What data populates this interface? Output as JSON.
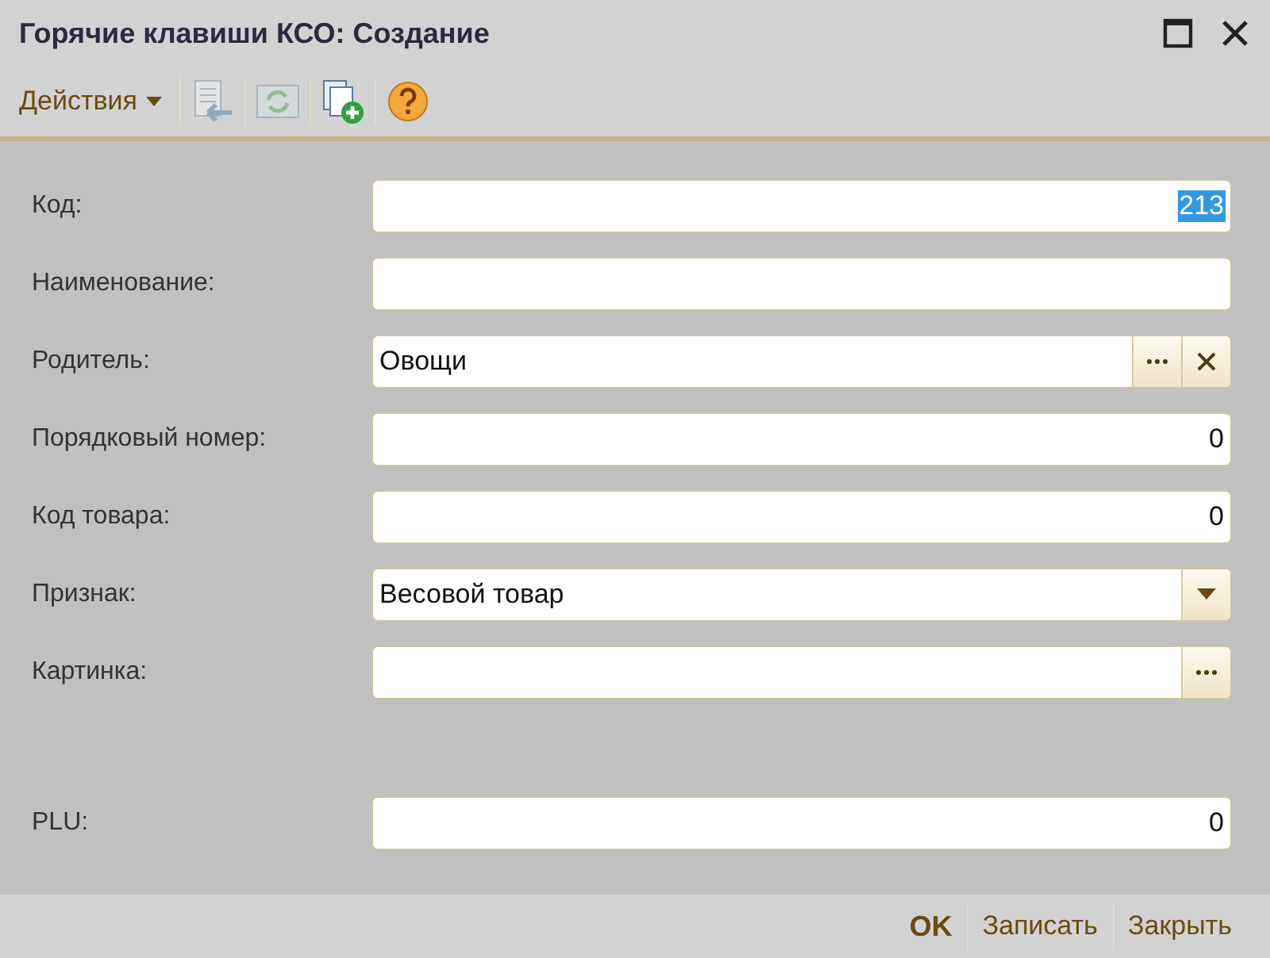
{
  "window": {
    "title": "Горячие клавиши КСО: Создание"
  },
  "toolbar": {
    "menu": "Действия",
    "icons": [
      {
        "kind": "paste",
        "disabled": true
      },
      {
        "kind": "refresh",
        "disabled": true
      },
      {
        "kind": "copy-add",
        "disabled": false
      },
      {
        "kind": "help",
        "disabled": false
      }
    ]
  },
  "fields": [
    {
      "label": "Код:",
      "kind": "number",
      "value": "213",
      "selected": true
    },
    {
      "label": "Наименование:",
      "kind": "text"
    },
    {
      "label": "Родитель:",
      "kind": "reference",
      "value": "Овощи"
    },
    {
      "label": "Порядковый номер:",
      "kind": "number",
      "value": "0"
    },
    {
      "label": "Код товара:",
      "kind": "number",
      "value": "0"
    },
    {
      "label": "Признак:",
      "kind": "dropdown",
      "value": "Весовой товар"
    },
    {
      "label": "Картинка:",
      "kind": "picker"
    }
  ],
  "extra_fields": [
    {
      "label": "PLU:",
      "kind": "number",
      "value": "0"
    }
  ],
  "buttons": [
    {
      "label": "OK",
      "default": true
    },
    {
      "label": "Записать",
      "default": false
    },
    {
      "label": "Закрыть",
      "default": false
    }
  ]
}
